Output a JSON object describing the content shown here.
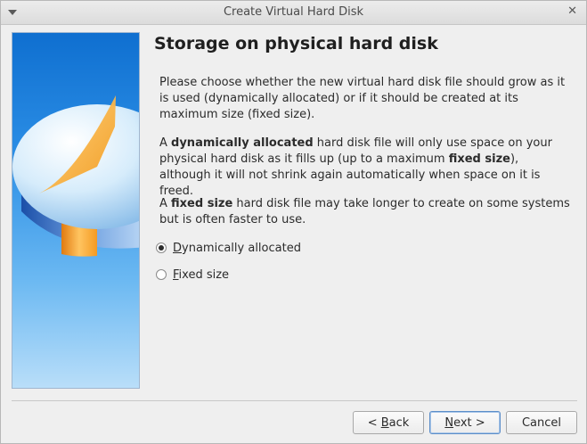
{
  "window": {
    "title": "Create Virtual Hard Disk",
    "close_glyph": "✕"
  },
  "page": {
    "title": "Storage on physical hard disk",
    "intro": "Please choose whether the new virtual hard disk file should grow as it is used (dynamically allocated) or if it should be created at its maximum size (fixed size).",
    "dynamic_desc": {
      "p1": "A ",
      "b1": "dynamically allocated",
      "p2": " hard disk file will only use space on your physical hard disk as it fills up (up to a maximum ",
      "b2": "fixed size",
      "p3": "), although it will not shrink again automatically when space on it is freed."
    },
    "fixed_desc": {
      "p1": "A ",
      "b1": "fixed size",
      "p2": " hard disk file may take longer to create on some systems but is often faster to use."
    }
  },
  "options": [
    {
      "mnemonic": "D",
      "rest": "ynamically allocated",
      "checked": true
    },
    {
      "mnemonic": "F",
      "rest": "ixed size",
      "checked": false
    }
  ],
  "buttons": {
    "back": {
      "prefix": "< ",
      "mnemonic": "B",
      "rest": "ack"
    },
    "next": {
      "mnemonic": "N",
      "rest": "ext >"
    },
    "cancel": "Cancel"
  },
  "icons": {
    "window_menu": "chevron-down-icon",
    "close": "close-icon",
    "banner": "hard-disk-illustration"
  },
  "colors": {
    "banner_blue": "#1f7fdc",
    "pie_orange": "#f6a623",
    "default_button_border": "#5c8ec9"
  }
}
